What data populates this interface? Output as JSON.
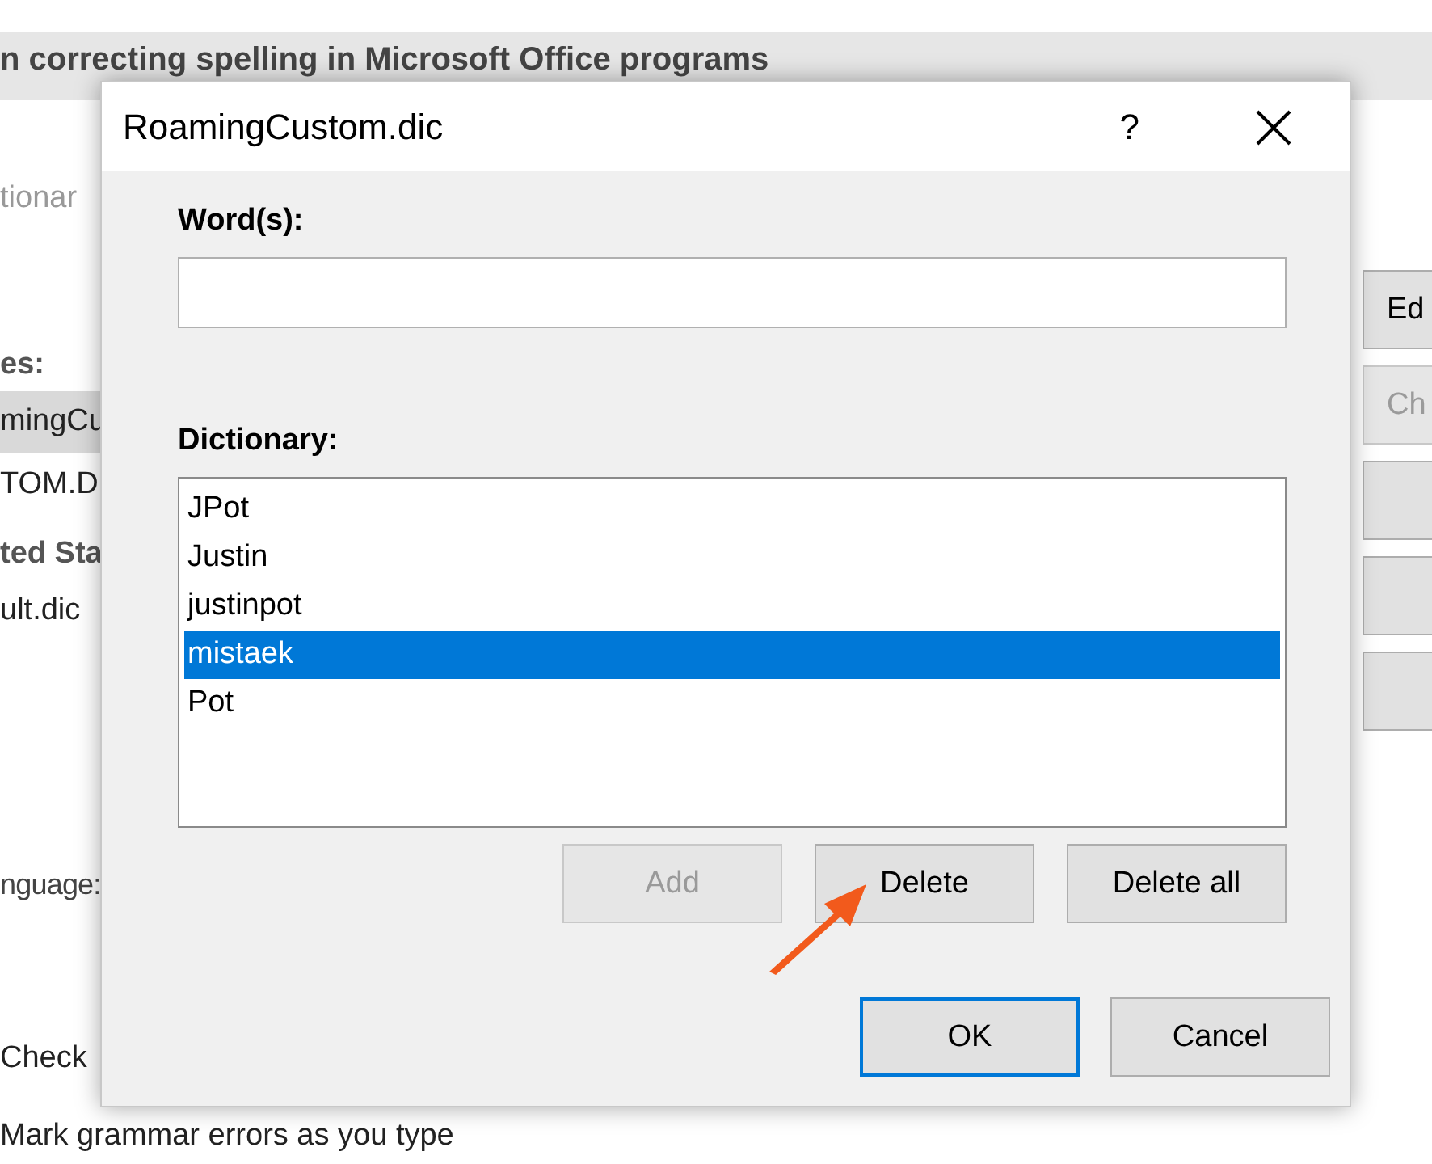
{
  "background_window": {
    "heading": "n correcting spelling in Microsoft Office programs",
    "tab": "tionar",
    "list_label": "es:",
    "items": [
      {
        "label": "mingCu",
        "selected": true
      },
      {
        "label": "TOM.D",
        "selected": false
      }
    ],
    "section_label": "ted Sta",
    "section_item": "ult.dic",
    "language_label": "nguage:",
    "options": [
      "Check",
      "Mark grammar errors as you type"
    ],
    "buttons": [
      {
        "kind": "text",
        "label": "Ed",
        "disabled": false
      },
      {
        "kind": "text",
        "label": "Ch",
        "disabled": true
      },
      {
        "kind": "blank"
      },
      {
        "kind": "blank"
      },
      {
        "kind": "blank"
      }
    ]
  },
  "dialog": {
    "title": "RoamingCustom.dic",
    "help": "?",
    "words_label": "Word(s):",
    "dictionary_label": "Dictionary:",
    "entries": [
      {
        "label": "JPot",
        "selected": false
      },
      {
        "label": "Justin",
        "selected": false
      },
      {
        "label": "justinpot",
        "selected": false
      },
      {
        "label": "mistaek",
        "selected": true
      },
      {
        "label": "Pot",
        "selected": false
      }
    ],
    "list_buttons": [
      {
        "label": "Add",
        "disabled": true
      },
      {
        "label": "Delete",
        "disabled": false
      },
      {
        "label": "Delete all",
        "disabled": false
      }
    ],
    "footer_buttons": [
      {
        "label": "OK",
        "default": true
      },
      {
        "label": "Cancel",
        "default": false
      }
    ]
  }
}
